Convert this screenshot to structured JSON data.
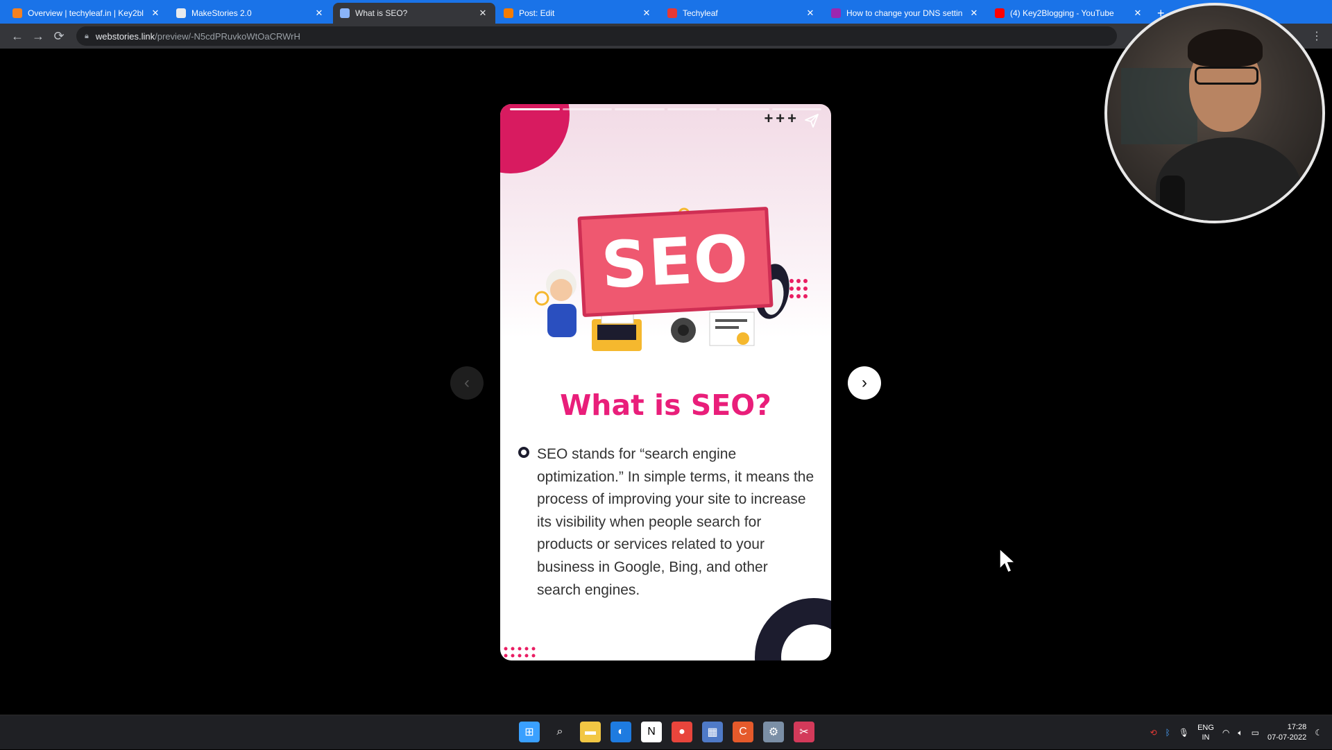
{
  "browser": {
    "tabs": [
      {
        "label": "Overview | techyleaf.in | Key2bl",
        "favicon": "cloudflare-icon",
        "favicon_color": "#f48120"
      },
      {
        "label": "MakeStories 2.0",
        "favicon": "makestories-icon",
        "favicon_color": "#e8eaed"
      },
      {
        "label": "What is SEO?",
        "favicon": "globe-icon",
        "favicon_color": "#8ab4f8",
        "active": true
      },
      {
        "label": "Post: Edit",
        "favicon": "blogger-icon",
        "favicon_color": "#f57c00"
      },
      {
        "label": "Techyleaf",
        "favicon": "techyleaf-icon",
        "favicon_color": "#e53935"
      },
      {
        "label": "How to change your DNS settin",
        "favicon": "bird-icon",
        "favicon_color": "#9c27b0"
      },
      {
        "label": "(4) Key2Blogging - YouTube",
        "favicon": "youtube-icon",
        "favicon_color": "#ff0000"
      }
    ],
    "url_host": "webstories.link",
    "url_path": "/preview/-N5cdPRuvkoWtOaCRWrH"
  },
  "story": {
    "seo_badge": "SEO",
    "title": "What is SEO?",
    "body": "SEO stands for “search engine optimization.” In simple terms, it means the process of improving your site to increase its visibility when people search for products or services related to your business in Google, Bing, and other search engines.",
    "progress_segments": 6,
    "progress_current": 1,
    "accent_color": "#e91e7a",
    "dark_color": "#1c1c2e"
  },
  "taskbar": {
    "apps": [
      "windows-start-icon",
      "search-icon",
      "file-explorer-icon",
      "edge-icon",
      "notion-icon",
      "chrome-icon",
      "photos-icon",
      "canva-icon",
      "settings-icon",
      "snipping-tool-icon"
    ],
    "lang_line1": "ENG",
    "lang_line2": "IN",
    "time": "17:28",
    "date": "07-07-2022"
  }
}
